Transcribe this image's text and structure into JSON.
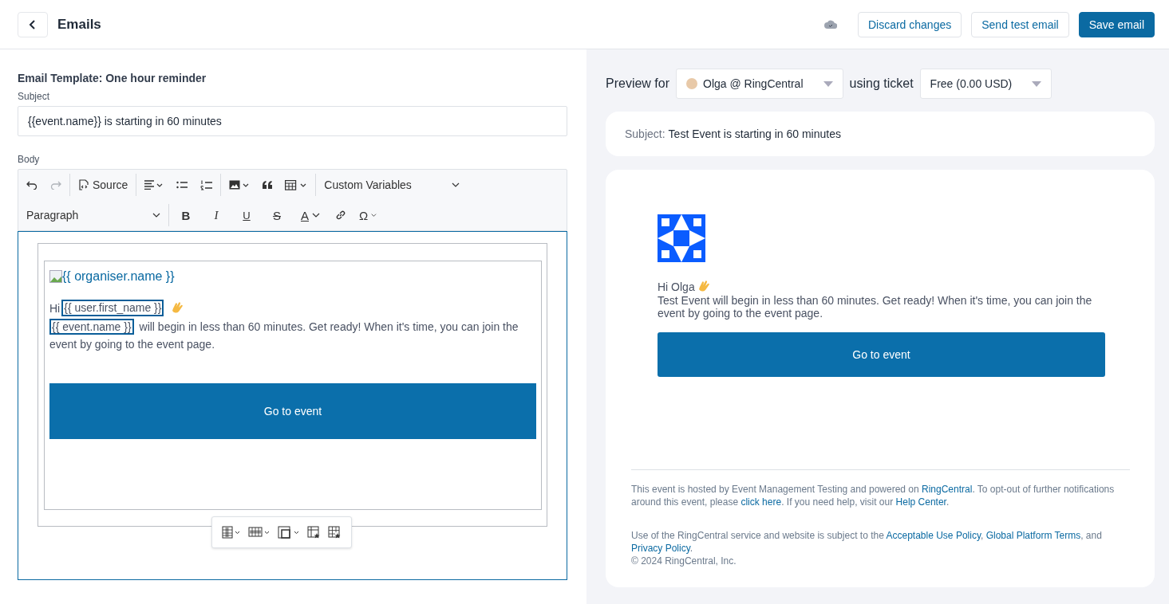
{
  "header": {
    "title": "Emails",
    "buttons": [
      {
        "label": "Discard changes",
        "kind": "secondary"
      },
      {
        "label": "Send test email",
        "kind": "secondary"
      },
      {
        "label": "Save email",
        "kind": "primary"
      }
    ]
  },
  "editor": {
    "template_title": "Email Template: One hour reminder",
    "subject_label": "Subject",
    "subject_value": "{{event.name}} is starting in 60 minutes",
    "body_label": "Body",
    "toolbar": {
      "redo_disabled": true,
      "source": "Source",
      "custom_variables": "Custom Variables",
      "paragraph": "Paragraph",
      "format_glyphs": [
        "B",
        "I",
        "U",
        "S",
        "A"
      ],
      "special_glyph": "Ω"
    },
    "content": {
      "organiser": "{{ organiser.name }}",
      "greeting": "Hi",
      "user_var": "{{ user.first_name }}",
      "event_var": "{{ event.name }}",
      "body": "will begin in less than 60 minutes. Get ready! When it's time, you can join the event by going to the event page.",
      "button": "Go to event"
    }
  },
  "preview": {
    "label": "Preview for",
    "attendee": "Olga @ RingCentral",
    "ticket_label": "using ticket",
    "ticket": "Free (0.00 USD)",
    "subject_label": "Subject:",
    "subject": "Test Event is starting in 60 minutes",
    "greeting": "Hi Olga",
    "body": "Test Event will begin in less than 60 minutes. Get ready! When it's time, you can join the event by going to the event page.",
    "button": "Go to event",
    "footer": [
      [
        {
          "text": "This event is hosted by Event Management Testing and powered on ",
          "link": false
        },
        {
          "text": "RingCentral",
          "link": true
        },
        {
          "text": ". To opt-out of further notifications around this event, please ",
          "link": false
        },
        {
          "text": "click here",
          "link": true
        },
        {
          "text": ". If you need help, visit our ",
          "link": false
        },
        {
          "text": "Help Center",
          "link": true
        },
        {
          "text": ".",
          "link": false
        }
      ],
      [
        {
          "text": "Use of the RingCentral service and website is subject to the ",
          "link": false
        },
        {
          "text": "Acceptable Use Policy",
          "link": true
        },
        {
          "text": ", ",
          "link": false
        },
        {
          "text": "Global Platform Terms",
          "link": true
        },
        {
          "text": ", and ",
          "link": false
        },
        {
          "text": "Privacy Policy",
          "link": true
        },
        {
          "text": ".",
          "link": false
        }
      ]
    ],
    "copyright": "© 2024 RingCentral, Inc."
  }
}
